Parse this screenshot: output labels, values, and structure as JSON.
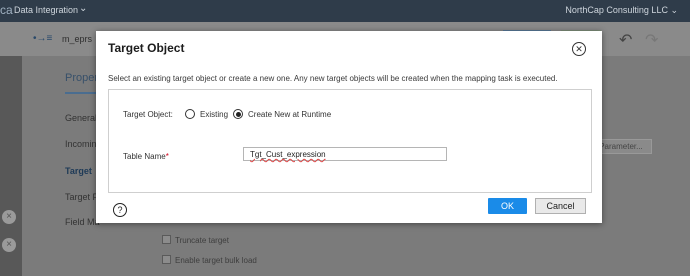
{
  "topbar": {
    "brand": "ca",
    "app": "Data Integration",
    "app_chevron": "⌄",
    "org": "NorthCap Consulting LLC ⌄"
  },
  "subbar": {
    "mapping_icon": "mapping-icon",
    "mapping_name": "m_eprs"
  },
  "panel": {
    "properties_label": "Propert",
    "nav": [
      "General",
      "Incoming",
      "Target",
      "Target F",
      "Field Ma"
    ],
    "parameter_button": "Parameter...",
    "checkboxes": [
      "Truncate target",
      "Enable target bulk load"
    ]
  },
  "dialog": {
    "title": "Target Object",
    "instructions": "Select an existing target object or create a new one. Any new target objects will be created when the mapping task is executed.",
    "target_object_label": "Target Object:",
    "option_existing": "Existing",
    "option_create": "Create New at Runtime",
    "selected_option": "Create New at Runtime",
    "table_name_label": "Table Name",
    "required_marker": "*",
    "table_name_value": "Tgt_Cust_expression",
    "ok_label": "OK",
    "cancel_label": "Cancel",
    "help_icon": "?",
    "close_icon": "✕"
  },
  "colors": {
    "primary_button": "#1a8be8",
    "required": "#d0021b"
  }
}
